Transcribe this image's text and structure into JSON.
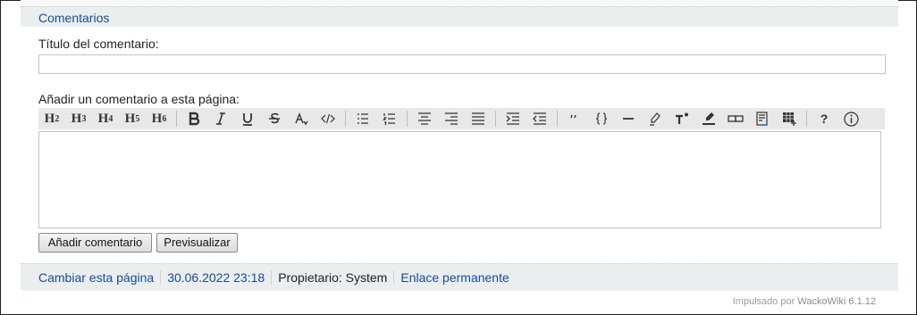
{
  "section": {
    "title": "Comentarios"
  },
  "form": {
    "title_label": "Título del comentario:",
    "title_value": "",
    "body_label": "Añadir un comentario a esta página:",
    "body_value": "",
    "submit_label": "Añadir comentario",
    "preview_label": "Previsualizar"
  },
  "toolbar": {
    "h2": "2",
    "h3": "3",
    "h4": "4",
    "h5": "5",
    "h6": "6",
    "headings": [
      "h2-icon",
      "h3-icon",
      "h4-icon",
      "h5-icon",
      "h6-icon"
    ],
    "icons": [
      "bold-icon",
      "italic-icon",
      "underline-icon",
      "strikethrough-icon",
      "text-color-icon",
      "code-icon",
      "bulleted-list-icon",
      "numbered-list-icon",
      "align-center-icon",
      "align-right-icon",
      "justify-icon",
      "indent-icon",
      "outdent-icon",
      "quote-icon",
      "braces-icon",
      "horizontal-rule-icon",
      "highlight-icon",
      "superscript-icon",
      "marker-icon",
      "link-icon",
      "footnote-icon",
      "table-icon",
      "help-icon",
      "info-icon"
    ]
  },
  "footer": {
    "edit": "Cambiar esta página",
    "date": "30.06.2022 23:18",
    "owner": "Propietario: System",
    "permalink": "Enlace permanente"
  },
  "powered": {
    "prefix": "Impulsado por ",
    "link": "WackoWiki 6.1.12"
  },
  "colors": {
    "link": "#1a4a9a",
    "bar": "#eaeeee",
    "toolbar": "#e8e8e8"
  }
}
